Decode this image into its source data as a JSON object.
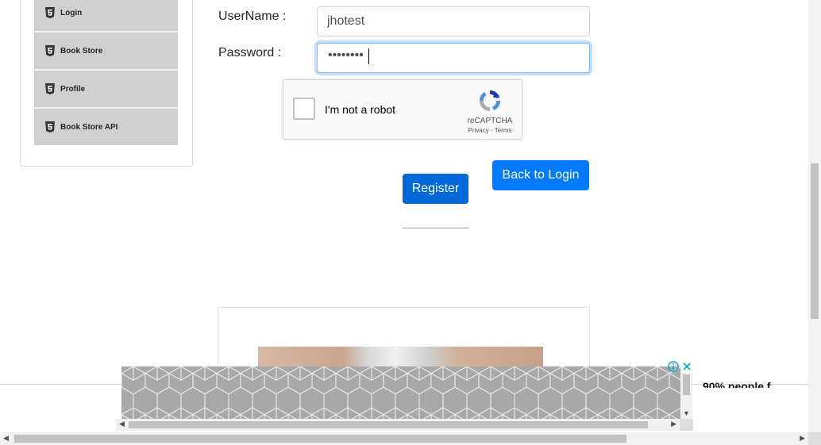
{
  "sidebar": {
    "items": [
      {
        "label": "Login",
        "icon": "html5-icon"
      },
      {
        "label": "Book Store",
        "icon": "html5-icon"
      },
      {
        "label": "Profile",
        "icon": "html5-icon"
      },
      {
        "label": "Book Store API",
        "icon": "html5-icon"
      }
    ]
  },
  "form": {
    "username_label": "UserName :",
    "username_value": "jhotest",
    "password_label": "Password :",
    "password_masked": "••••••••"
  },
  "captcha": {
    "label": "I'm not a robot",
    "brand": "reCAPTCHA",
    "links": "Privacy - Terms"
  },
  "buttons": {
    "register": "Register",
    "back_to_login": "Back to Login"
  },
  "ad": {
    "partial_text": "90% people f..."
  },
  "colors": {
    "primary": "#007bff",
    "primary_dark": "#0069d9",
    "sidebar_item_bg": "#d0d0d0",
    "ad_close": "#00aecd"
  }
}
